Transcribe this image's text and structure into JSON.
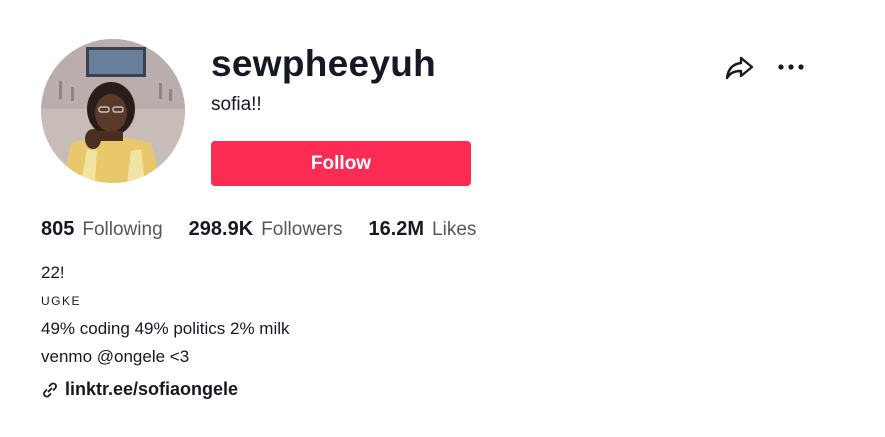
{
  "profile": {
    "username": "sewpheeyuh",
    "nickname": "sofia!!",
    "follow_label": "Follow"
  },
  "stats": [
    {
      "value": "805",
      "label": "Following"
    },
    {
      "value": "298.9K",
      "label": "Followers"
    },
    {
      "value": "16.2M",
      "label": "Likes"
    }
  ],
  "bio": {
    "lines": [
      "22!",
      "UGKE",
      "49% coding 49% politics 2% milk",
      "venmo @ongele <3"
    ]
  },
  "link": {
    "text": "linktr.ee/sofiaongele",
    "icon": "link-icon"
  },
  "header_actions": {
    "share_icon": "share-icon",
    "more_icon": "more-icon"
  },
  "colors": {
    "accent": "#fe2c55",
    "text": "#161823",
    "secondary_text": "#56575e"
  }
}
